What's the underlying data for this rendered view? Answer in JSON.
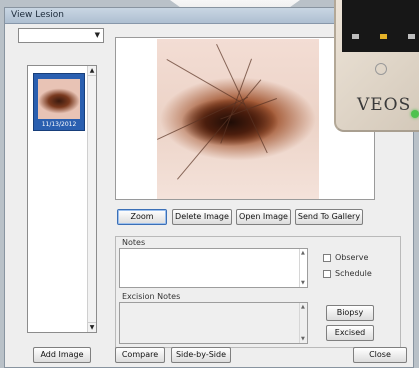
{
  "window": {
    "title": "View Lesion"
  },
  "thumbnail": {
    "date": "11/13/2012"
  },
  "toolbar": {
    "zoom": "Zoom",
    "delete_image": "Delete Image",
    "open_image": "Open Image",
    "send_to_gallery": "Send To Gallery"
  },
  "notes": {
    "label": "Notes",
    "observe": "Observe",
    "schedule": "Schedule",
    "excision_label": "Excision Notes",
    "biopsy": "Biopsy",
    "excised": "Excised"
  },
  "bottom": {
    "add_image": "Add Image",
    "compare": "Compare",
    "side_by_side": "Side-by-Side",
    "close": "Close"
  },
  "device": {
    "brand": "VEOS"
  },
  "colors": {
    "selection": "#2a5fb0",
    "led": "#4ec24e"
  }
}
